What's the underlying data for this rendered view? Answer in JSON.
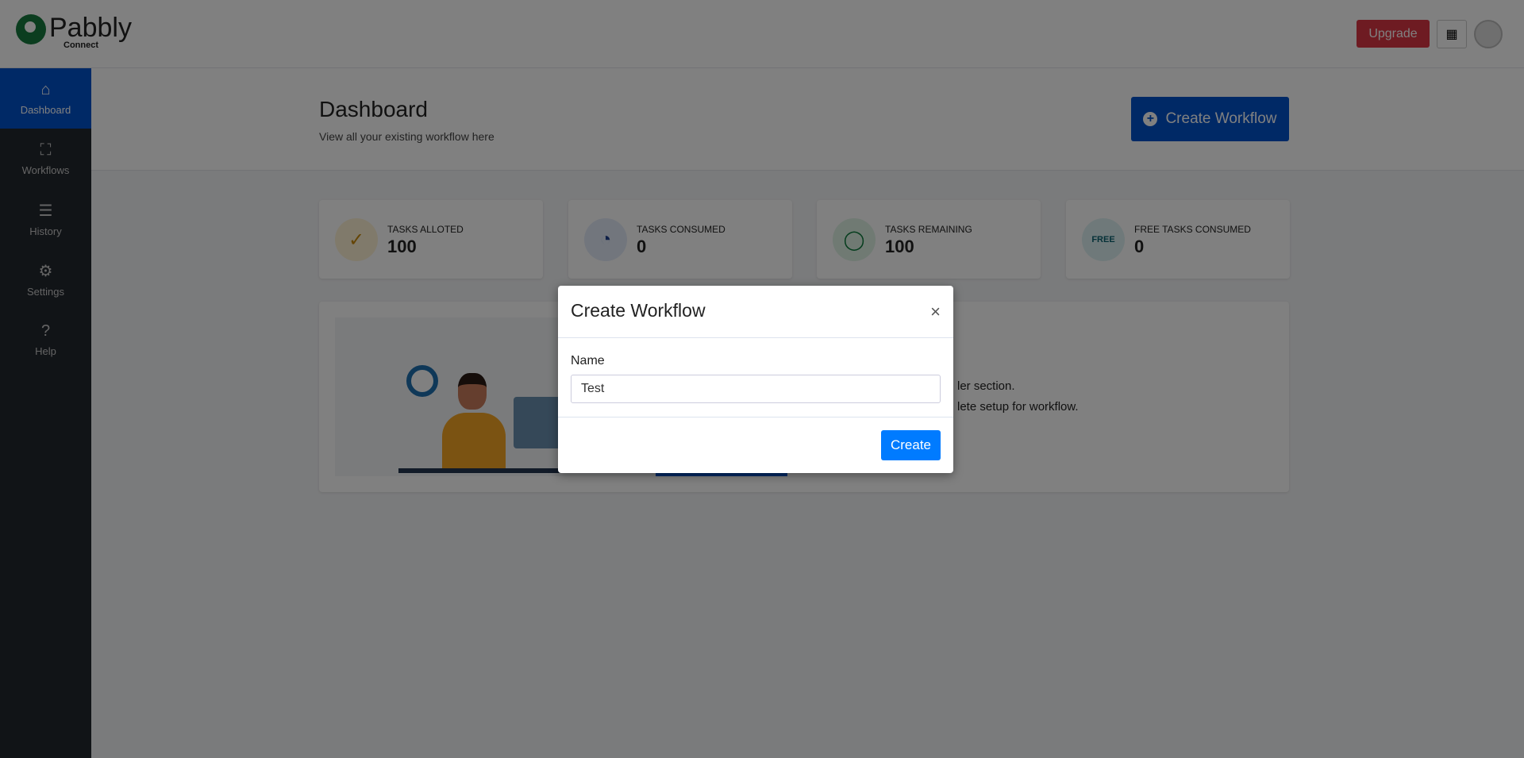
{
  "brand": {
    "name": "Pabbly",
    "sub": "Connect"
  },
  "topbar": {
    "upgrade": "Upgrade",
    "apps_icon": "grid-icon",
    "avatar_icon": "user-avatar"
  },
  "sidebar": {
    "items": [
      {
        "label": "Dashboard",
        "icon": "home-icon",
        "active": true
      },
      {
        "label": "Workflows",
        "icon": "workflow-icon"
      },
      {
        "label": "History",
        "icon": "list-check-icon"
      },
      {
        "label": "Settings",
        "icon": "gear-icon"
      },
      {
        "label": "Help",
        "icon": "question-icon"
      }
    ]
  },
  "page": {
    "title": "Dashboard",
    "subtitle": "View all your existing workflow here",
    "create_button": "Create Workflow"
  },
  "stats": [
    {
      "label": "TASKS ALLOTED",
      "value": "100",
      "icon": "badge-check-icon",
      "color": "#c98a0c"
    },
    {
      "label": "TASKS CONSUMED",
      "value": "0",
      "icon": "pie-chart-icon",
      "color": "#1d3f8f"
    },
    {
      "label": "TASKS REMAINING",
      "value": "100",
      "icon": "donut-icon",
      "color": "#0a7a3a"
    },
    {
      "label": "FREE TASKS CONSUMED",
      "value": "0",
      "icon": "free-badge-icon",
      "color": "#0b6270"
    }
  ],
  "banner": {
    "line1_fragment": "ler section.",
    "line2_fragment": "lete setup for workflow."
  },
  "modal": {
    "title": "Create Workflow",
    "name_label": "Name",
    "name_value": "Test",
    "create": "Create"
  }
}
